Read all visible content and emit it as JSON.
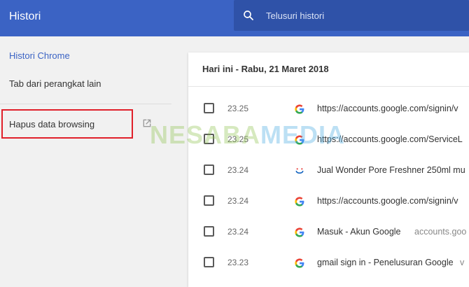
{
  "header": {
    "title": "Histori",
    "search_placeholder": "Telusuri histori"
  },
  "sidebar": {
    "items": [
      {
        "label": "Histori Chrome"
      },
      {
        "label": "Tab dari perangkat lain"
      },
      {
        "label": "Hapus data browsing"
      }
    ]
  },
  "history": {
    "date_header": "Hari ini - Rabu, 21 Maret 2018",
    "rows": [
      {
        "time": "23.25",
        "title": "https://accounts.google.com/signin/v",
        "domain": "",
        "favicon": "google-icon"
      },
      {
        "time": "23.25",
        "title": "https://accounts.google.com/ServiceL",
        "domain": "",
        "favicon": "google-icon"
      },
      {
        "time": "23.24",
        "title": "Jual Wonder Pore Freshner 250ml mu",
        "domain": "",
        "favicon": "smile-icon"
      },
      {
        "time": "23.24",
        "title": "https://accounts.google.com/signin/v",
        "domain": "",
        "favicon": "google-icon"
      },
      {
        "time": "23.24",
        "title": "Masuk - Akun Google",
        "domain": "accounts.goo",
        "favicon": "google-icon"
      },
      {
        "time": "23.23",
        "title": "gmail sign in - Penelusuran Google",
        "domain": "v",
        "favicon": "google-icon"
      }
    ]
  },
  "watermark": {
    "part1": "NESABA",
    "part2": "MEDIA"
  },
  "colors": {
    "topbar": "#3b63c4",
    "search": "#2f52a8",
    "highlight": "#e0202a",
    "accent": "#3b63c4"
  }
}
